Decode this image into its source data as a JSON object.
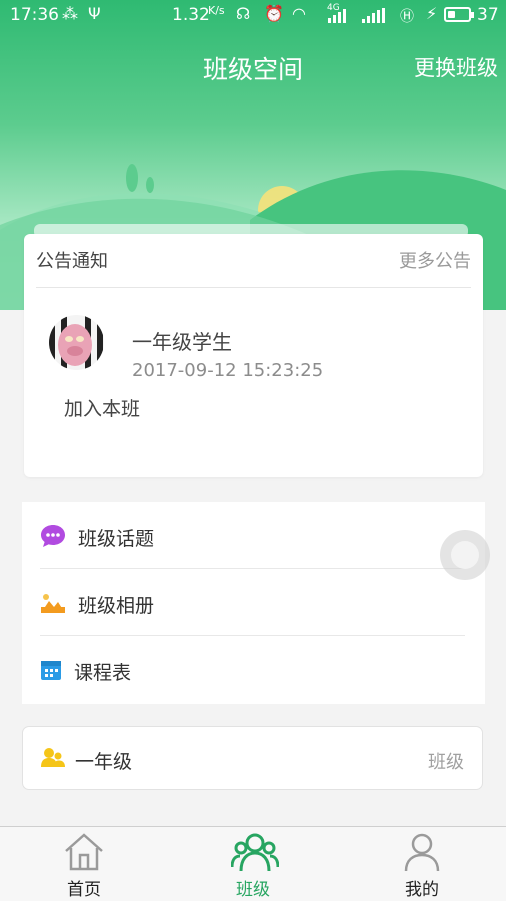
{
  "status_bar": {
    "time": "17:36",
    "speed": "1.32",
    "speed_unit": "K/s",
    "network": "4G",
    "battery": "37",
    "battery_level": 0.37
  },
  "header": {
    "title": "班级空间",
    "action": "更换班级"
  },
  "notice": {
    "title": "公告通知",
    "more": "更多公告",
    "poster_name": "一年级学生",
    "time": "2017-09-12 15:23:25",
    "content": "加入本班"
  },
  "menu": {
    "items": [
      {
        "label": "班级话题",
        "icon": "chat-bubble-icon"
      },
      {
        "label": "班级相册",
        "icon": "photo-album-icon"
      },
      {
        "label": "课程表",
        "icon": "calendar-icon"
      }
    ]
  },
  "class_card": {
    "name": "一年级",
    "tag": "班级",
    "icon": "people-icon"
  },
  "tabs": [
    {
      "label": "首页",
      "icon": "home-icon",
      "active": false
    },
    {
      "label": "班级",
      "icon": "class-group-icon",
      "active": true
    },
    {
      "label": "我的",
      "icon": "profile-icon",
      "active": false
    }
  ],
  "colors": {
    "brand_green": "#2fba72",
    "active_tab": "#27a561",
    "topic_purple": "#b14be0",
    "album_orange": "#f39b1f",
    "calendar_blue": "#2a9be6",
    "people_yellow": "#f5c518"
  }
}
